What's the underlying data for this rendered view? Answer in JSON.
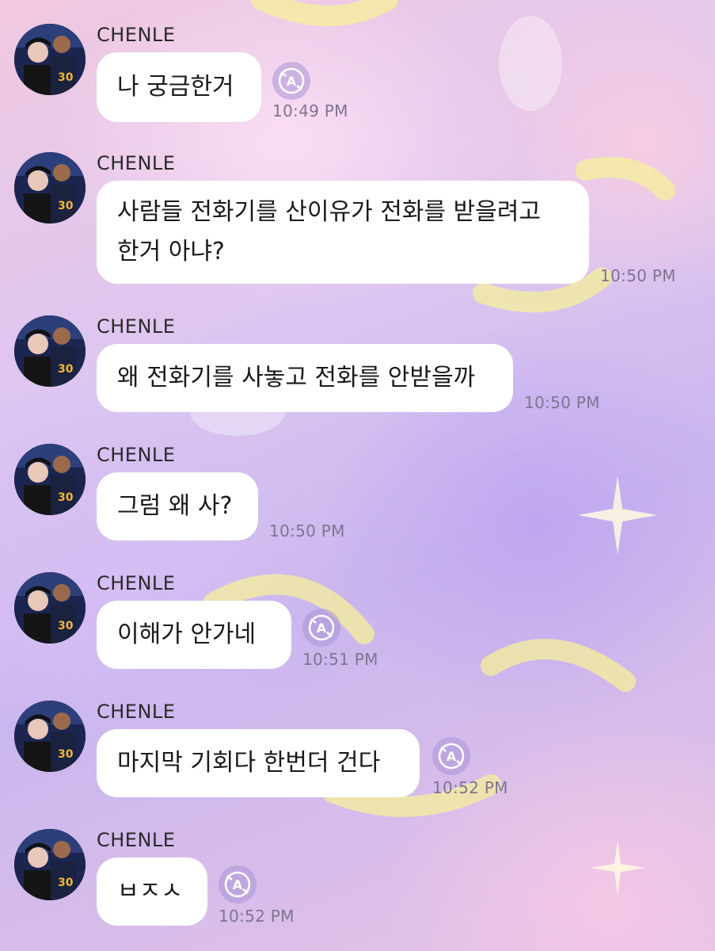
{
  "chat": {
    "messages": [
      {
        "sender": "CHENLE",
        "text": "나 궁금한거",
        "time": "10:49 PM",
        "translate_icon": "translate-icon"
      },
      {
        "sender": "CHENLE",
        "text": "사람들 전화기를 산이유가 전화를 받을려고\n한거 아냐?",
        "time": "10:50 PM"
      },
      {
        "sender": "CHENLE",
        "text": "왜 전화기를 사놓고 전화를 안받을까",
        "time": "10:50 PM"
      },
      {
        "sender": "CHENLE",
        "text": "그럼 왜 사?",
        "time": "10:50 PM"
      },
      {
        "sender": "CHENLE",
        "text": "이해가 안가네",
        "time": "10:51 PM",
        "translate_icon": "translate-icon"
      },
      {
        "sender": "CHENLE",
        "text": "마지막 기회다 한번더 건다",
        "time": "10:52 PM",
        "translate_icon": "translate-icon"
      },
      {
        "sender": "CHENLE",
        "text": "ㅂㅈㅅ",
        "time": "10:52 PM",
        "translate_icon": "translate-icon"
      }
    ]
  },
  "colors": {
    "bubble": "#ffffff",
    "timestamp": "#7d7590",
    "translate_icon": "#a896d6"
  }
}
